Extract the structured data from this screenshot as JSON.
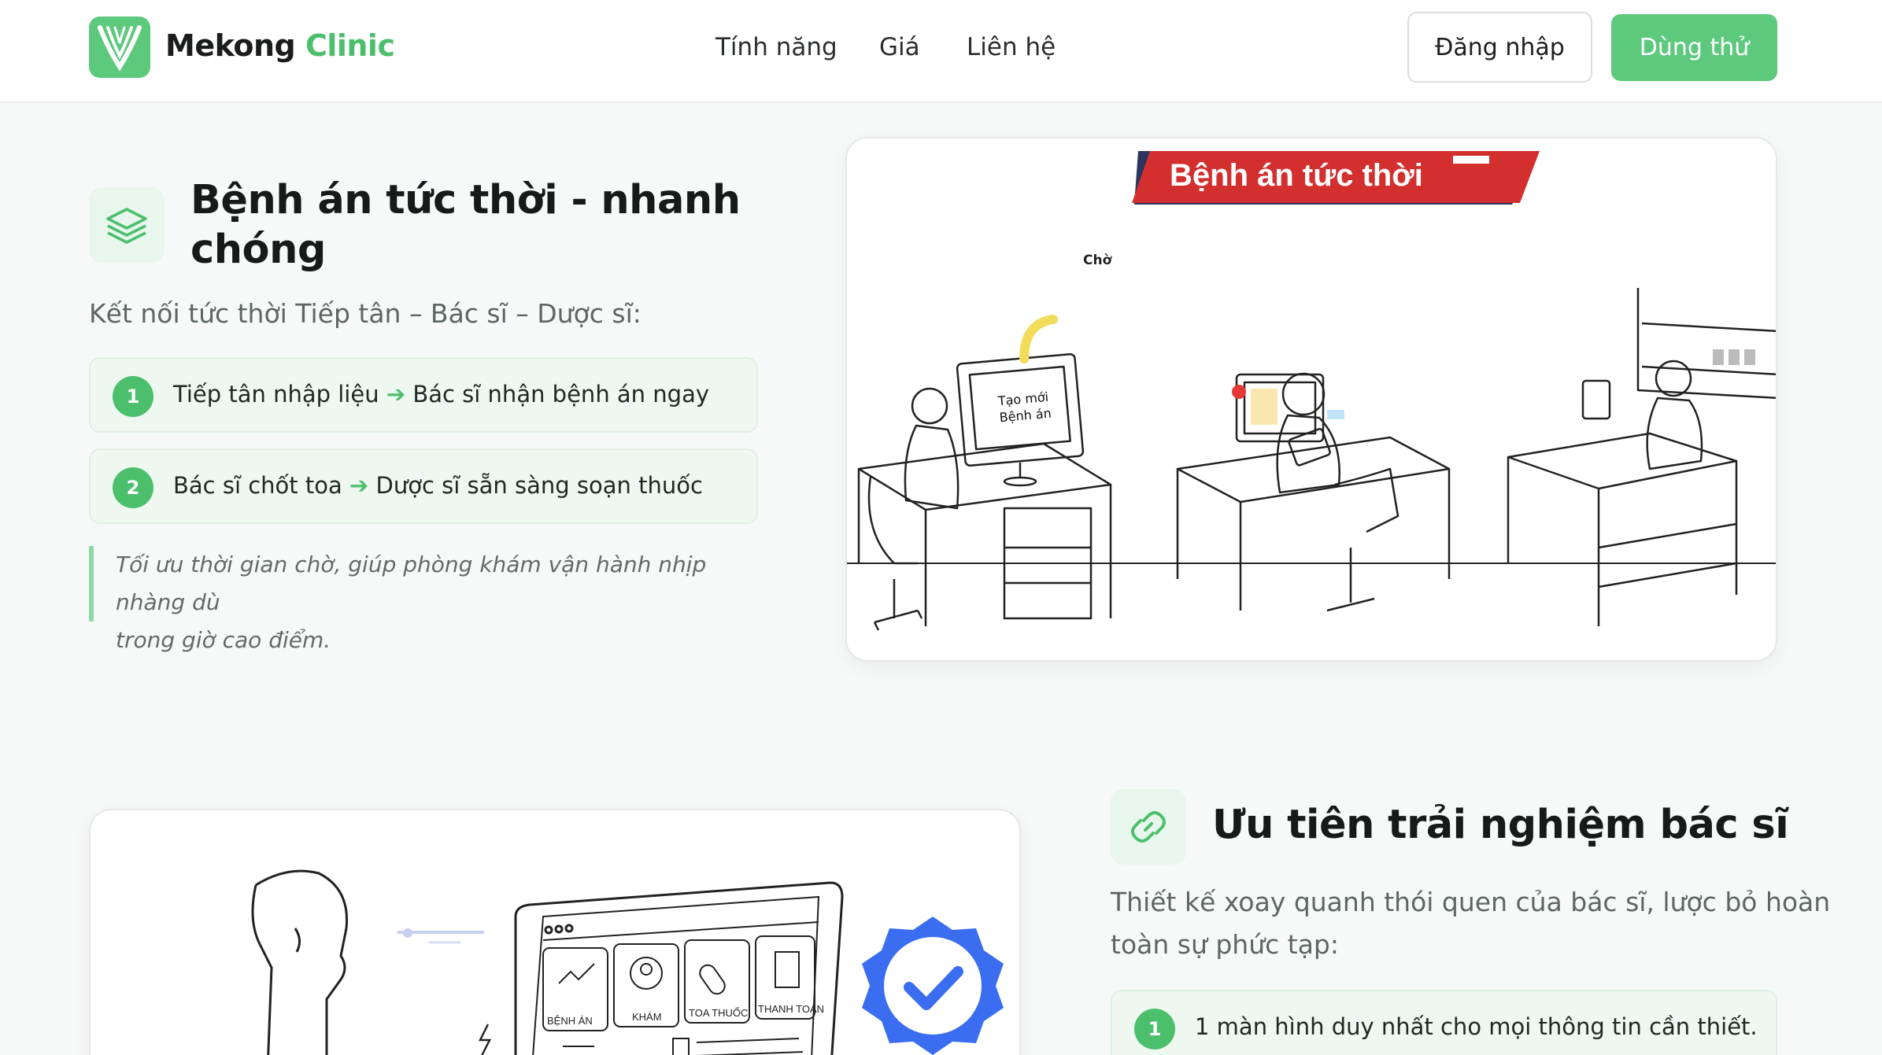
{
  "header": {
    "brand_first": "Mekong",
    "brand_second": "Clinic",
    "nav": [
      "Tính năng",
      "Giá",
      "Liên hệ"
    ],
    "login_label": "Đăng nhập",
    "trial_label": "Dùng thử",
    "brand_color": "#5cc97c"
  },
  "section1": {
    "icon": "layers-icon",
    "title_line1": "Bệnh án tức thời - nhanh",
    "title_line2": "chóng",
    "lead": "Kết nối tức thời Tiếp tân – Bác sĩ – Dược sĩ:",
    "steps": [
      {
        "num": "1",
        "before": "Tiếp tân nhập liệu",
        "after": "Bác sĩ nhận bệnh án ngay"
      },
      {
        "num": "2",
        "before": "Bác sĩ chốt toa",
        "after": "Dược sĩ sẵn sàng soạn thuốc"
      }
    ],
    "arrow": "➔",
    "quote_line1": "Tối ưu thời gian chờ, giúp phòng khám vận hành nhịp nhàng dù",
    "quote_line2": "trong giờ cao điểm.",
    "illustration": {
      "banner": "Bệnh án tức thời",
      "wait_label": "Chờ",
      "monitor_line1": "Tạo mới",
      "monitor_line2": "Bệnh án"
    }
  },
  "section2": {
    "icon": "link-icon",
    "title": "Ưu tiên trải nghiệm bác sĩ",
    "lead_line1": "Thiết kế xoay quanh thói quen của bác sĩ, lược bỏ hoàn",
    "lead_line2": "toàn sự phức tạp:",
    "steps": [
      {
        "num": "1",
        "text": "1 màn hình duy nhất cho mọi thông tin cần thiết."
      }
    ],
    "illustration": {
      "tabs": [
        "BỆNH ÁN",
        "KHÁM",
        "TOA THUỐC",
        "THANH TOÁN"
      ]
    }
  }
}
